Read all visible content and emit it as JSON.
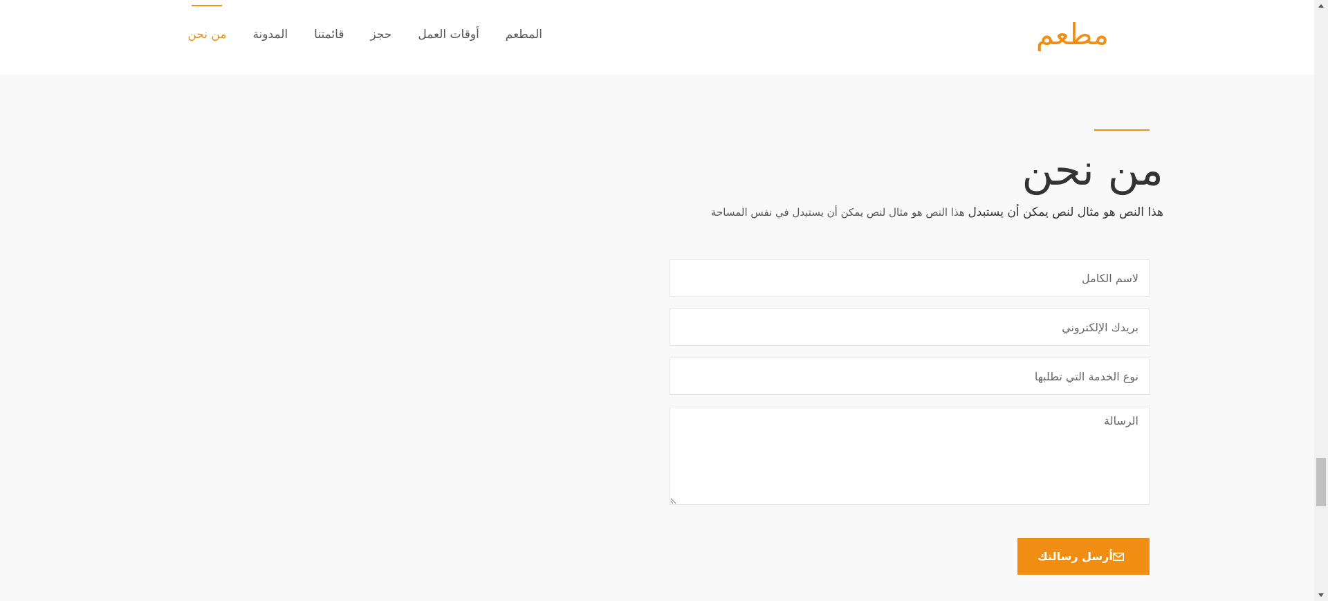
{
  "header": {
    "logo": "مطعم",
    "nav": [
      {
        "label": "المطعم",
        "active": false
      },
      {
        "label": "أوقات العمل",
        "active": false
      },
      {
        "label": "حجز",
        "active": false
      },
      {
        "label": "قائمتنا",
        "active": false
      },
      {
        "label": "المدونة",
        "active": false
      },
      {
        "label": "من نحن",
        "active": true
      }
    ]
  },
  "section": {
    "title": "من نحن",
    "description_strong": "هذا النص هو مثال لنص يمكن أن يستبدل",
    "description_rest": " هذا النص هو مثال لنص يمكن أن يستبدل في نفس المساحة"
  },
  "form": {
    "name_placeholder": "لاسم الكامل",
    "email_placeholder": "بريدك الإلكتروني",
    "service_placeholder": "نوع الخدمة التي تطلبها",
    "message_placeholder": "الرسالة",
    "submit_label": "أرسل رسالتك",
    "submit_icon": "envelope-icon"
  },
  "colors": {
    "accent": "#ef8e12",
    "background": "#f9f9f9",
    "text": "#555555",
    "heading": "#333333"
  }
}
